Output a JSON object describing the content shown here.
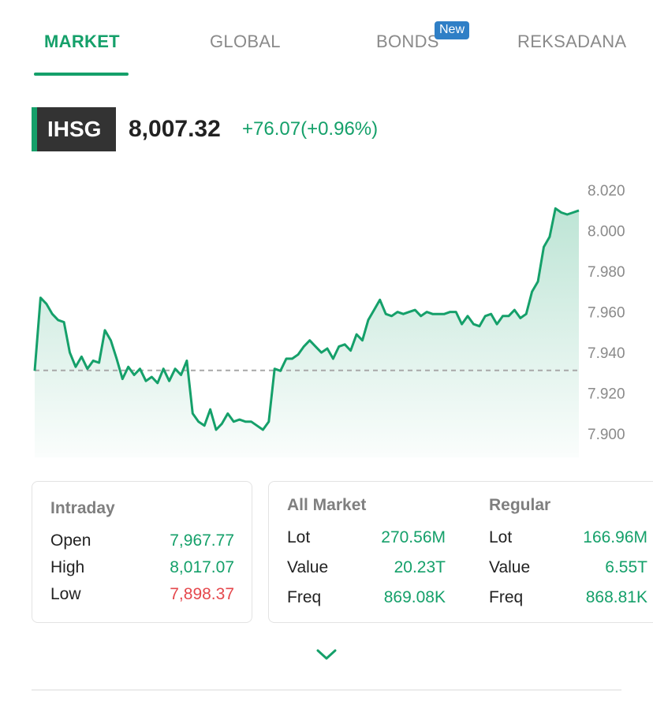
{
  "tabs": [
    {
      "label": "MARKET",
      "active": true
    },
    {
      "label": "GLOBAL",
      "active": false
    },
    {
      "label": "BONDS",
      "active": false,
      "badge": "New"
    },
    {
      "label": "REKSADANA",
      "active": false
    }
  ],
  "index": {
    "name": "IHSG",
    "value": "8,007.32",
    "change": "+76.07(+0.96%)"
  },
  "colors": {
    "accent": "#15a06a",
    "negative": "#e5484d",
    "badge": "#2f7fc6",
    "tag_bg": "#333333"
  },
  "chart_data": {
    "type": "area",
    "y_ticks": [
      "8.020",
      "8.000",
      "7.980",
      "7.960",
      "7.940",
      "7.920",
      "7.900"
    ],
    "ylim": [
      7.895,
      8.022
    ],
    "baseline": 7.9312,
    "baseline_style": "dashed",
    "series": [
      {
        "values": [
          7.931,
          7.967,
          7.964,
          7.959,
          7.956,
          7.955,
          7.94,
          7.933,
          7.938,
          7.932,
          7.936,
          7.935,
          7.951,
          7.946,
          7.937,
          7.927,
          7.933,
          7.929,
          7.932,
          7.926,
          7.928,
          7.925,
          7.932,
          7.926,
          7.932,
          7.929,
          7.936,
          7.91,
          7.906,
          7.904,
          7.912,
          7.902,
          7.905,
          7.91,
          7.906,
          7.907,
          7.906,
          7.906,
          7.904,
          7.902,
          7.906,
          7.932,
          7.931,
          7.937,
          7.937,
          7.939,
          7.943,
          7.946,
          7.943,
          7.94,
          7.942,
          7.937,
          7.943,
          7.944,
          7.941,
          7.949,
          7.946,
          7.956,
          7.961,
          7.966,
          7.959,
          7.958,
          7.96,
          7.959,
          7.96,
          7.961,
          7.958,
          7.96,
          7.959,
          7.959,
          7.959,
          7.96,
          7.96,
          7.954,
          7.958,
          7.954,
          7.953,
          7.958,
          7.959,
          7.954,
          7.958,
          7.958,
          7.961,
          7.957,
          7.959,
          7.97,
          7.975,
          7.992,
          7.997,
          8.011,
          8.009,
          8.008,
          8.009,
          8.01
        ]
      }
    ]
  },
  "intraday": {
    "title": "Intraday",
    "rows": [
      {
        "label": "Open",
        "value": "7,967.77",
        "status": "up"
      },
      {
        "label": "High",
        "value": "8,017.07",
        "status": "up"
      },
      {
        "label": "Low",
        "value": "7,898.37",
        "status": "down"
      }
    ]
  },
  "all_market": {
    "title": "All Market",
    "rows": [
      {
        "label": "Lot",
        "value": "270.56M"
      },
      {
        "label": "Value",
        "value": "20.23T"
      },
      {
        "label": "Freq",
        "value": "869.08K"
      }
    ]
  },
  "regular": {
    "title": "Regular",
    "rows": [
      {
        "label": "Lot",
        "value": "166.96M"
      },
      {
        "label": "Value",
        "value": "6.55T"
      },
      {
        "label": "Freq",
        "value": "868.81K"
      }
    ]
  },
  "expand_icon": "chevron-down-icon"
}
